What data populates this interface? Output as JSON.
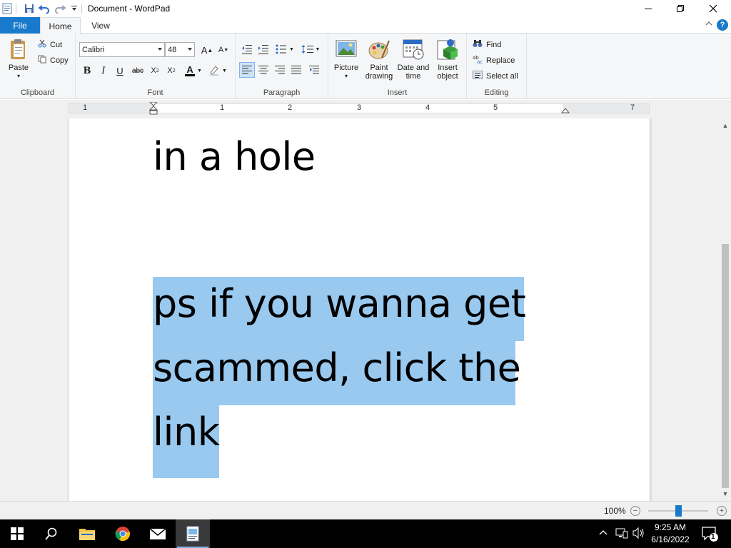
{
  "window": {
    "title": "Document - WordPad",
    "minimize": "—",
    "maximize": "❐",
    "close": "✕"
  },
  "tabs": {
    "file": "File",
    "home": "Home",
    "view": "View"
  },
  "clipboard": {
    "paste": "Paste",
    "cut": "Cut",
    "copy": "Copy",
    "label": "Clipboard"
  },
  "font": {
    "family": "Calibri",
    "size": "48",
    "label": "Font"
  },
  "paragraph": {
    "label": "Paragraph"
  },
  "insert": {
    "picture": "Picture",
    "paint": "Paint drawing",
    "datetime": "Date and time",
    "object": "Insert object",
    "label": "Insert"
  },
  "editing": {
    "find": "Find",
    "replace": "Replace",
    "select_all": "Select all",
    "label": "Editing"
  },
  "ruler": {
    "numbers": [
      "1",
      "1",
      "2",
      "3",
      "4",
      "5",
      "7"
    ]
  },
  "document": {
    "lines": [
      "in a hole",
      "ps if you wanna get",
      "scammed, click the",
      "link"
    ]
  },
  "status": {
    "zoom": "100%",
    "zoom_level": 0.5
  },
  "taskbar": {
    "time": "9:25 AM",
    "date": "6/16/2022",
    "notification_count": "1"
  },
  "colors": {
    "accent": "#1979ca",
    "selection": "#99c9ef"
  }
}
